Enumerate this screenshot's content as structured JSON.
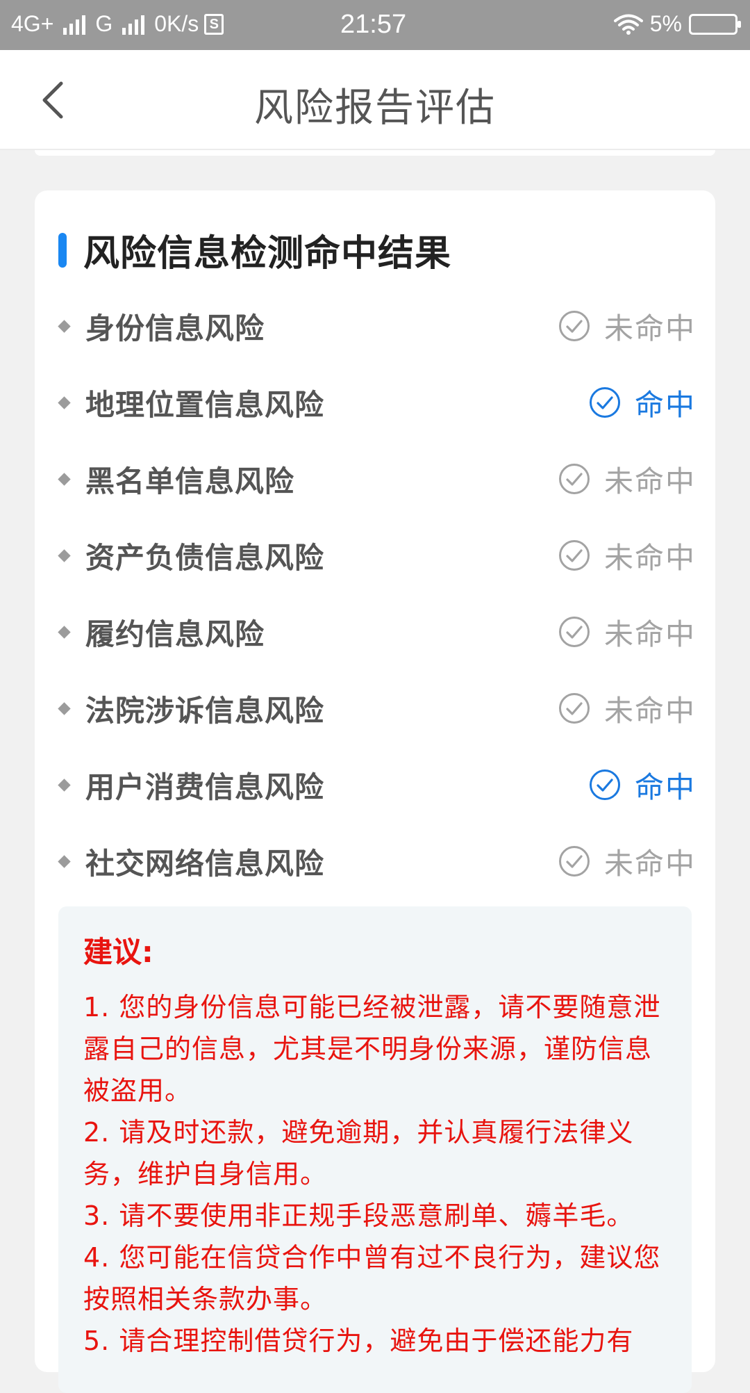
{
  "status_bar": {
    "net1": "4G+",
    "net2": "G",
    "speed": "0K/s",
    "time": "21:57",
    "battery": "5%"
  },
  "nav": {
    "title": "风险报告评估"
  },
  "card": {
    "title": "风险信息检测命中结果",
    "items": [
      {
        "label": "身份信息风险",
        "status": "未命中",
        "hit": false
      },
      {
        "label": "地理位置信息风险",
        "status": "命中",
        "hit": true
      },
      {
        "label": "黑名单信息风险",
        "status": "未命中",
        "hit": false
      },
      {
        "label": "资产负债信息风险",
        "status": "未命中",
        "hit": false
      },
      {
        "label": "履约信息风险",
        "status": "未命中",
        "hit": false
      },
      {
        "label": "法院涉诉信息风险",
        "status": "未命中",
        "hit": false
      },
      {
        "label": "用户消费信息风险",
        "status": "命中",
        "hit": true
      },
      {
        "label": "社交网络信息风险",
        "status": "未命中",
        "hit": false
      }
    ]
  },
  "advice": {
    "title": "建议:",
    "items": [
      "1. 您的身份信息可能已经被泄露，请不要随意泄露自己的信息，尤其是不明身份来源，谨防信息被盗用。",
      "2. 请及时还款，避免逾期，并认真履行法律义务，维护自身信用。",
      "3. 请不要使用非正规手段恶意刷单、薅羊毛。",
      "4. 您可能在信贷合作中曾有过不良行为，建议您按照相关条款办事。",
      "5. 请合理控制借贷行为，避免由于偿还能力有"
    ]
  },
  "colors": {
    "accent": "#1a87f2",
    "hit": "#1a79e0",
    "miss": "#a3a3a3",
    "advice_text": "#e8140f",
    "advice_bg": "#f2f6f8",
    "status_bar": "#9a9a9a"
  },
  "icons": {
    "back": "chevron-left-icon",
    "check": "check-circle-icon",
    "bullet": "diamond-bullet-icon"
  }
}
